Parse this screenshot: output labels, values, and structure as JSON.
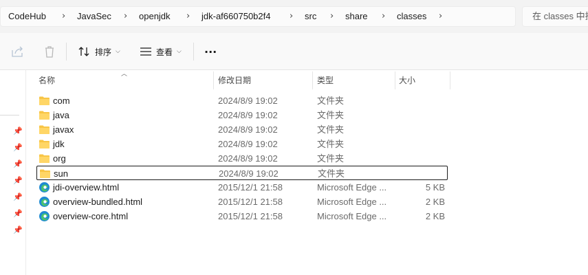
{
  "breadcrumb": [
    "CodeHub",
    "JavaSec",
    "openjdk",
    "jdk-af660750b2f4",
    "src",
    "share",
    "classes"
  ],
  "search": {
    "placeholder": "在 classes 中搜"
  },
  "toolbar": {
    "sort_label": "排序",
    "view_label": "查看",
    "more_label": "···"
  },
  "columns": {
    "name": "名称",
    "date": "修改日期",
    "type": "类型",
    "size": "大小"
  },
  "files": [
    {
      "name": "com",
      "date": "2024/8/9 19:02",
      "type": "文件夹",
      "size": "",
      "icon": "folder-icon"
    },
    {
      "name": "java",
      "date": "2024/8/9 19:02",
      "type": "文件夹",
      "size": "",
      "icon": "folder-icon"
    },
    {
      "name": "javax",
      "date": "2024/8/9 19:02",
      "type": "文件夹",
      "size": "",
      "icon": "folder-icon"
    },
    {
      "name": "jdk",
      "date": "2024/8/9 19:02",
      "type": "文件夹",
      "size": "",
      "icon": "folder-icon"
    },
    {
      "name": "org",
      "date": "2024/8/9 19:02",
      "type": "文件夹",
      "size": "",
      "icon": "folder-icon"
    },
    {
      "name": "sun",
      "date": "2024/8/9 19:02",
      "type": "文件夹",
      "size": "",
      "icon": "folder-icon",
      "selected": true
    },
    {
      "name": "jdi-overview.html",
      "date": "2015/12/1 21:58",
      "type": "Microsoft Edge ...",
      "size": "5 KB",
      "icon": "edge-html-icon"
    },
    {
      "name": "overview-bundled.html",
      "date": "2015/12/1 21:58",
      "type": "Microsoft Edge ...",
      "size": "2 KB",
      "icon": "edge-html-icon"
    },
    {
      "name": "overview-core.html",
      "date": "2015/12/1 21:58",
      "type": "Microsoft Edge ...",
      "size": "2 KB",
      "icon": "edge-html-icon"
    }
  ],
  "colors": {
    "folder": "#f8c545",
    "edge": "#1f8ad2",
    "selection_border": "#1a1a1a"
  }
}
